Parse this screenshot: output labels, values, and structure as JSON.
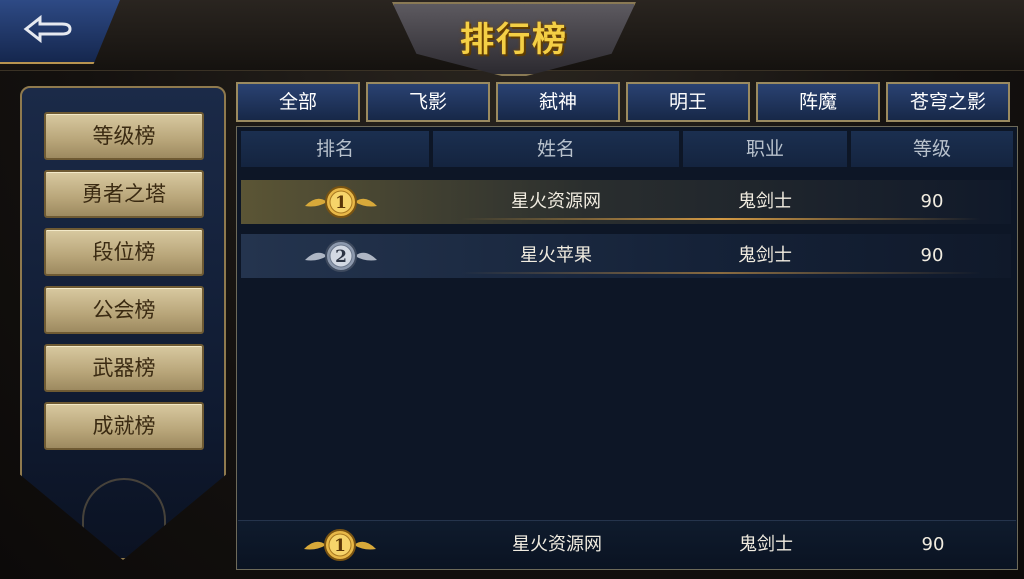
{
  "title": "排行榜",
  "sidebar": {
    "items": [
      {
        "label": "等级榜"
      },
      {
        "label": "勇者之塔"
      },
      {
        "label": "段位榜"
      },
      {
        "label": "公会榜"
      },
      {
        "label": "武器榜"
      },
      {
        "label": "成就榜"
      }
    ]
  },
  "tabs": [
    {
      "label": "全部"
    },
    {
      "label": "飞影"
    },
    {
      "label": "弑神"
    },
    {
      "label": "明王"
    },
    {
      "label": "阵魔"
    },
    {
      "label": "苍穹之影"
    }
  ],
  "table": {
    "headers": [
      "排名",
      "姓名",
      "职业",
      "等级"
    ],
    "rows": [
      {
        "rank": "1",
        "name": "星火资源网",
        "job": "鬼剑士",
        "level": "90"
      },
      {
        "rank": "2",
        "name": "星火苹果",
        "job": "鬼剑士",
        "level": "90"
      }
    ]
  },
  "my_rank": {
    "rank": "1",
    "name": "星火资源网",
    "job": "鬼剑士",
    "level": "90"
  },
  "colors": {
    "gold": "#f4cf45",
    "silver": "#c9ced8",
    "accent_blue": "#2a4272"
  }
}
